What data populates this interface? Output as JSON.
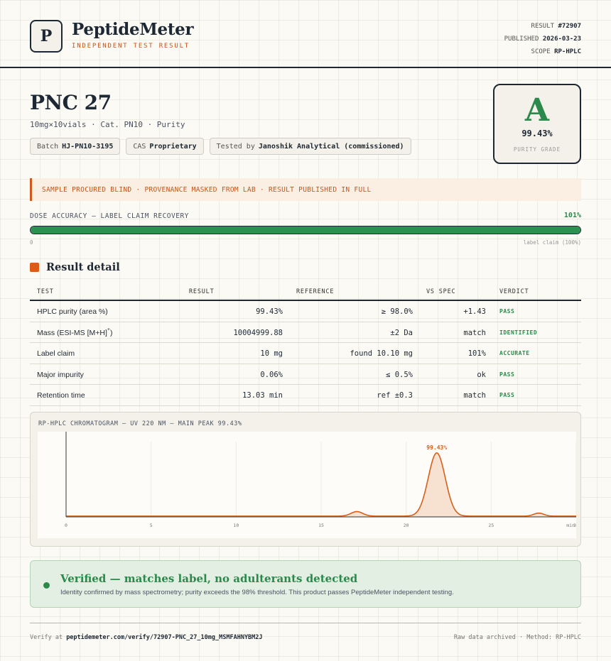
{
  "header": {
    "logo_letter": "P",
    "brand": "PeptideMeter",
    "brand_sub": "INDEPENDENT TEST RESULT",
    "meta": [
      {
        "label": "RESULT",
        "value": "#72907"
      },
      {
        "label": "PUBLISHED",
        "value": "2026-03-23"
      },
      {
        "label": "SCOPE",
        "value": "RP-HPLC"
      }
    ]
  },
  "product": {
    "title": "PNC 27",
    "subtitle": "10mg×10vials · Cat. PN10 · Purity",
    "chips": [
      {
        "label": "Batch",
        "value": "HJ-PN10-3195"
      },
      {
        "label": "CAS",
        "value": "Proprietary"
      },
      {
        "label": "Tested by",
        "value": "Janoshik Analytical (commissioned)"
      }
    ]
  },
  "grade": {
    "letter": "A",
    "value": "99.43%",
    "label": "PURITY GRADE"
  },
  "notice": "SAMPLE PROCURED BLIND · PROVENANCE MASKED FROM LAB · RESULT PUBLISHED IN FULL",
  "dose": {
    "label": "DOSE ACCURACY — LABEL CLAIM RECOVERY",
    "value": "101%",
    "fill_fraction": 1.0,
    "min_label": "0",
    "max_label": "label claim (100%)"
  },
  "section": {
    "title": "Result detail"
  },
  "table": {
    "headers": [
      "TEST",
      "RESULT",
      "REFERENCE",
      "VS SPEC",
      "VERDICT"
    ],
    "rows": [
      {
        "test": "HPLC purity (area %)",
        "result": "99.43%",
        "reference": "≥ 98.0%",
        "vs_spec": "+1.43",
        "verdict": "PASS"
      },
      {
        "test": "Mass (ESI-MS [M+H]",
        "test_sup": "+",
        "test_end": ")",
        "result": "10004999.88",
        "reference": "±2 Da",
        "vs_spec": "match",
        "verdict": "IDENTIFIED"
      },
      {
        "test": "Label claim",
        "result": "10 mg",
        "reference": "found 10.10 mg",
        "vs_spec": "101%",
        "verdict": "ACCURATE"
      },
      {
        "test": "Major impurity",
        "result": "0.06%",
        "reference": "≤ 0.5%",
        "vs_spec": "ok",
        "verdict": "PASS"
      },
      {
        "test": "Retention time",
        "result": "13.03 min",
        "reference": "ref ±0.3",
        "vs_spec": "match",
        "verdict": "PASS"
      }
    ]
  },
  "chromatogram": {
    "title": "RP-HPLC CHROMATOGRAM — UV 220 NM — MAIN PEAK 99.43%"
  },
  "chart_data": {
    "type": "area",
    "title": "RP-HPLC CHROMATOGRAM — UV 220 NM — MAIN PEAK 99.43%",
    "xlabel": "min",
    "ylabel": "",
    "xlim": [
      0,
      30
    ],
    "ylim": [
      0,
      1.0
    ],
    "x_ticks": [
      0,
      5,
      10,
      15,
      20,
      25,
      30
    ],
    "x_tick_labels": [
      "0",
      "5",
      "10",
      "15",
      "20",
      "25",
      "30"
    ],
    "baseline": 0.01,
    "peaks": [
      {
        "center": 17.1,
        "height": 0.06,
        "width": 0.35
      },
      {
        "center": 21.8,
        "height": 0.84,
        "width": 0.5,
        "label": "99.43%"
      },
      {
        "center": 27.8,
        "height": 0.04,
        "width": 0.3
      }
    ],
    "colors": {
      "line": "#d6601c",
      "fill": "#f7e2d2",
      "axis": "#555555"
    }
  },
  "verified": {
    "title": "Verified — matches label, no adulterants detected",
    "subtitle": "Identity confirmed by mass spectrometry; purity exceeds the 98% threshold. This product passes PeptideMeter independent testing."
  },
  "footer": {
    "verify_prefix": "Verify at",
    "verify_url": "peptidemeter.com/verify/72907-PNC_27_10mg_MSMFAHNYBM2J",
    "right": "Raw data archived · Method: RP-HPLC"
  }
}
